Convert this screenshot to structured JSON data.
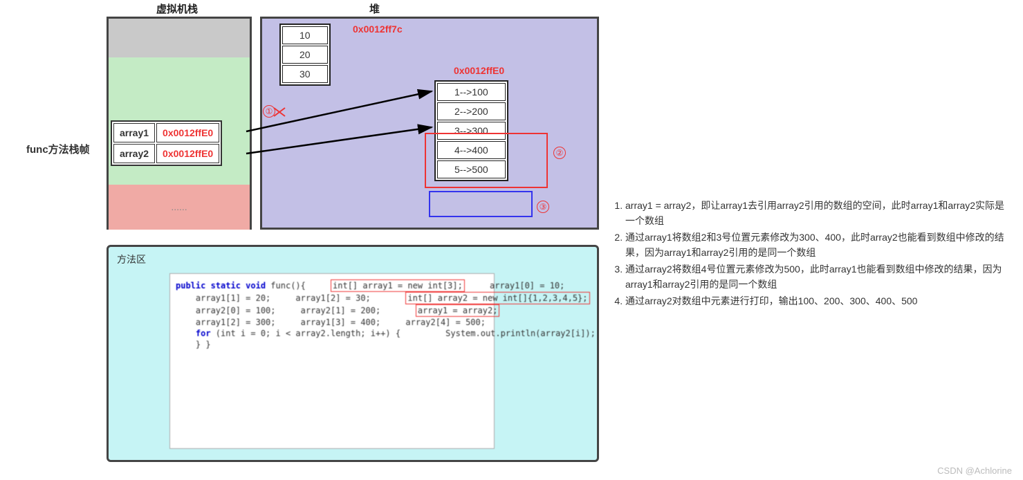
{
  "headings": {
    "stack": "虚拟机栈",
    "heap": "堆"
  },
  "frame_label": "func方法栈帧",
  "stack_table": {
    "r1": {
      "label": "array1",
      "addr": "0x0012ffE0"
    },
    "r2": {
      "label": "array2",
      "addr": "0x0012ffE0"
    }
  },
  "stack_ellipsis": "......",
  "heap": {
    "obj1": {
      "addr": "0x0012ff7c",
      "cells": [
        "10",
        "20",
        "30"
      ]
    },
    "obj2": {
      "addr": "0x0012ffE0",
      "cells": [
        "1-->100",
        "2-->200",
        "3-->300",
        "4-->400",
        "5-->500"
      ]
    }
  },
  "markers": {
    "m1": "①",
    "m2": "②",
    "m3": "③"
  },
  "method_area": {
    "title": "方法区"
  },
  "code": {
    "l1a": "public static void ",
    "l1b": "func",
    "l1c": "(){",
    "l2": "int[] array1 = new int[3];",
    "l3": "    array1[0] = 10;",
    "l4": "    array1[1] = 20;",
    "l5": "    array1[2] = 30;",
    "l6": "int[] array2 = new int[]{1,2,3,4,5};",
    "l7": "    array2[0] = 100;",
    "l8": "    array2[1] = 200;",
    "l9": "array1 = array2;",
    "l10": "    array1[2] = 300;",
    "l11": "    array1[3] = 400;",
    "l12": "    array2[4] = 500;",
    "l13a": "    for ",
    "l13b": "(int i = 0; i < array2.length; i++) {",
    "l14": "        System.out.println(array2[i]);",
    "l15": "    }",
    "l16": "}"
  },
  "explain": {
    "i1": "array1 = array2，即让array1去引用array2引用的数组的空间，此时array1和array2实际是一个数组",
    "i2": "通过array1将数组2和3号位置元素修改为300、400，此时array2也能看到数组中修改的结果，因为array1和array2引用的是同一个数组",
    "i3": "通过array2将数组4号位置元素修改为500，此时array1也能看到数组中修改的结果，因为array1和array2引用的是同一个数组",
    "i4": "通过array2对数组中元素进行打印，输出100、200、300、400、500"
  },
  "watermark": "CSDN @Achlorine"
}
